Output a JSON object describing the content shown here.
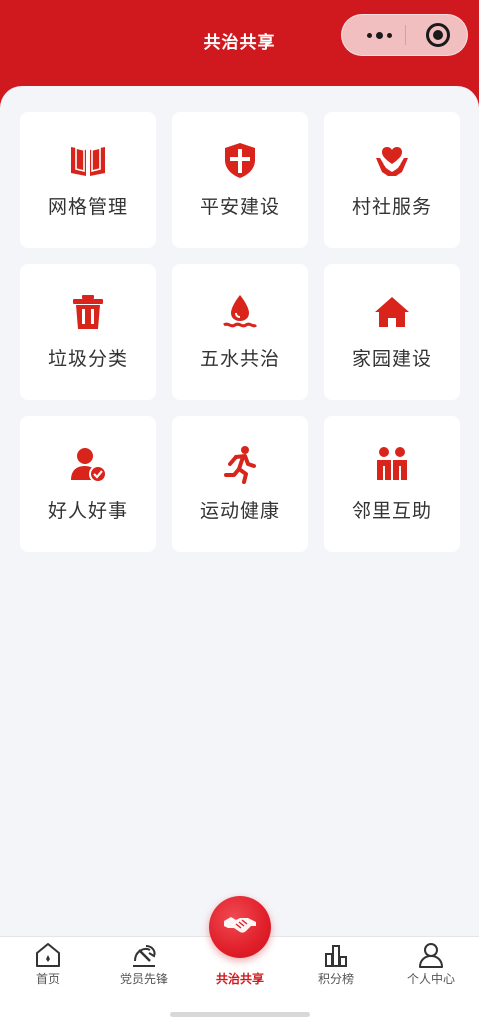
{
  "header": {
    "title": "共治共享",
    "background_color": "#d0191e"
  },
  "capsule": {
    "more_icon": "more-dots-icon",
    "close_icon": "target-close-icon"
  },
  "grid": {
    "items": [
      {
        "label": "网格管理",
        "icon": "book-icon"
      },
      {
        "label": "平安建设",
        "icon": "shield-icon"
      },
      {
        "label": "村社服务",
        "icon": "heart-hands-icon"
      },
      {
        "label": "垃圾分类",
        "icon": "trash-can-icon"
      },
      {
        "label": "五水共治",
        "icon": "water-drop-icon"
      },
      {
        "label": "家园建设",
        "icon": "home-icon"
      },
      {
        "label": "好人好事",
        "icon": "person-check-icon"
      },
      {
        "label": "运动健康",
        "icon": "running-person-icon"
      },
      {
        "label": "邻里互助",
        "icon": "neighbors-icon"
      }
    ],
    "icon_color": "#d9241c"
  },
  "tabbar": {
    "items": [
      {
        "label": "首页",
        "icon": "home-outline-icon",
        "active": false
      },
      {
        "label": "党员先锋",
        "icon": "party-emblem-icon",
        "active": false
      },
      {
        "label": "共治共享",
        "icon": "handshake-icon",
        "active": true
      },
      {
        "label": "积分榜",
        "icon": "bar-chart-icon",
        "active": false
      },
      {
        "label": "个人中心",
        "icon": "user-outline-icon",
        "active": false
      }
    ],
    "active_color": "#d0191e"
  }
}
